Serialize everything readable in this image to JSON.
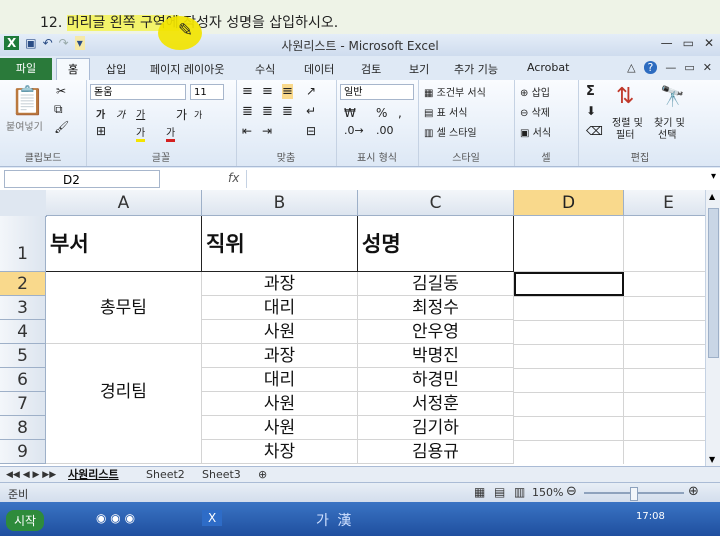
{
  "instruction": {
    "number": "12.",
    "highlighted": "머리글 왼쪽 구역에",
    "rest": " 작성자 성명을 삽입하시오."
  },
  "window": {
    "title": "사원리스트 - Microsoft Excel"
  },
  "tabs": [
    "파일",
    "홈",
    "삽입",
    "페이지 레이아웃",
    "수식",
    "데이터",
    "검토",
    "보기",
    "추가 기능",
    "Acrobat"
  ],
  "ribbon": {
    "clipboard": {
      "paste": "붙여넣기",
      "label": "클립보드"
    },
    "font": {
      "name": "돋움",
      "size": "11",
      "bold": "가",
      "italic": "가",
      "underline": "가",
      "grow": "가",
      "shrink": "가",
      "highlight": "가",
      "fontcolor": "가",
      "label": "글꼴"
    },
    "align": {
      "label": "맞춤"
    },
    "number": {
      "format": "일반",
      "percent": "%",
      "comma": ",",
      "label": "표시 형식"
    },
    "styles": {
      "cond": "조건부 서식",
      "table": "표 서식",
      "cell": "셀 스타일",
      "label": "스타일"
    },
    "cells": {
      "insert": "삽입",
      "delete": "삭제",
      "format": "서식",
      "label": "셀"
    },
    "editing": {
      "sum": "Σ",
      "sort": "정렬 및",
      "sort2": "필터",
      "find": "찾기 및",
      "find2": "선택",
      "label": "편집"
    }
  },
  "formula_bar": {
    "name_box": "D2",
    "fx": "fx",
    "value": ""
  },
  "columns": [
    "A",
    "B",
    "C",
    "D",
    "E"
  ],
  "rows": [
    "1",
    "2",
    "3",
    "4",
    "5",
    "6",
    "7",
    "8",
    "9"
  ],
  "headers": [
    "부서",
    "직위",
    "성명"
  ],
  "data": {
    "departments": [
      "총무팀",
      "경리팀"
    ],
    "positions": [
      "과장",
      "대리",
      "사원",
      "과장",
      "대리",
      "사원",
      "사원",
      "차장"
    ],
    "names": [
      "김길동",
      "최정수",
      "안우영",
      "박명진",
      "하경민",
      "서정훈",
      "김기하",
      "김용규"
    ]
  },
  "sheet_tabs": [
    "사원리스트",
    "Sheet2",
    "Sheet3"
  ],
  "status": {
    "ready": "준비",
    "zoom": "150%"
  },
  "taskbar": {
    "start": "시작",
    "time": "17:08",
    "ime": "가 漢"
  }
}
